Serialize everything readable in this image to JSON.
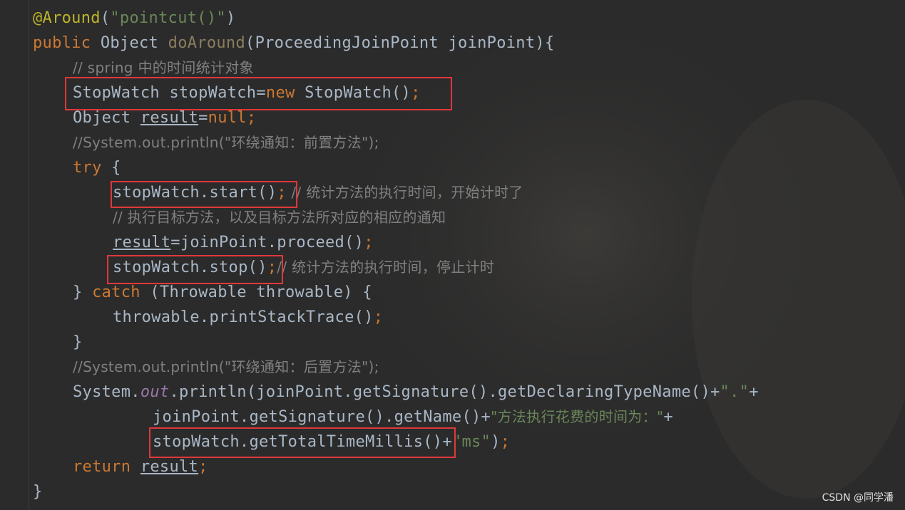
{
  "code": {
    "l1": {
      "annotation": "@Around",
      "p1": "(",
      "arg": "\"pointcut()\"",
      "p2": ")"
    },
    "l2": {
      "kw": "public",
      "type": " Object ",
      "method": "doAround",
      "rest": "(ProceedingJoinPoint joinPoint){"
    },
    "l3": {
      "comment": "// spring 中的时间统计对象"
    },
    "l4": {
      "a": "StopWatch stopWatch=",
      "kw": "new",
      "b": " StopWatch()",
      "semi": ";"
    },
    "l5": {
      "a": "Object ",
      "var": "result",
      "b": "=",
      "kw": "null",
      "semi": ";"
    },
    "l6": {
      "comment": "//System.out.println(\"环绕通知：前置方法\");"
    },
    "l7": {
      "kw": "try",
      "rest": " {"
    },
    "l8": {
      "a": "stopWatch.start()",
      "semi": ";",
      "comment": " // 统计方法的执行时间，开始计时了"
    },
    "l9": {
      "comment": "// 执行目标方法，以及目标方法所对应的相应的通知"
    },
    "l10": {
      "var": "result",
      "a": "=joinPoint.proceed()",
      "semi": ";"
    },
    "l11": {
      "a": "stopWatch.stop()",
      "semi": ";",
      "comment": "// 统计方法的执行时间，停止计时"
    },
    "l12": {
      "a": "} ",
      "kw": "catch",
      "b": " (Throwable throwable) {"
    },
    "l13": {
      "a": "throwable.printStackTrace()",
      "semi": ";"
    },
    "l14": {
      "a": "}"
    },
    "l15": {
      "comment": "//System.out.println(\"环绕通知：后置方法\");"
    },
    "l16": {
      "a": "System.",
      "stat": "out",
      "b": ".println(joinPoint.getSignature().getDeclaringTypeName()+",
      "str": "\".\"",
      "c": "+"
    },
    "l17": {
      "a": "joinPoint.getSignature().getName()+",
      "str": "\"方法执行花费的时间为：\"",
      "c": "+"
    },
    "l18": {
      "a": "stopWatch.getTotalTimeMillis()+",
      "str": "\"ms\"",
      "b": ")",
      "semi": ";"
    },
    "l19": {
      "kw": "return",
      "sp": " ",
      "var": "result",
      "semi": ";"
    },
    "l20": {
      "a": "}"
    }
  },
  "watermark": "CSDN @同学潘",
  "colors": {
    "background": "#2b2b2b",
    "keyword": "#cc7832",
    "annotation": "#bbb529",
    "string": "#6a8759",
    "comment": "#808080",
    "plain": "#a9b7c6",
    "static_field": "#9876aa",
    "highlight_box": "#e0383b"
  }
}
